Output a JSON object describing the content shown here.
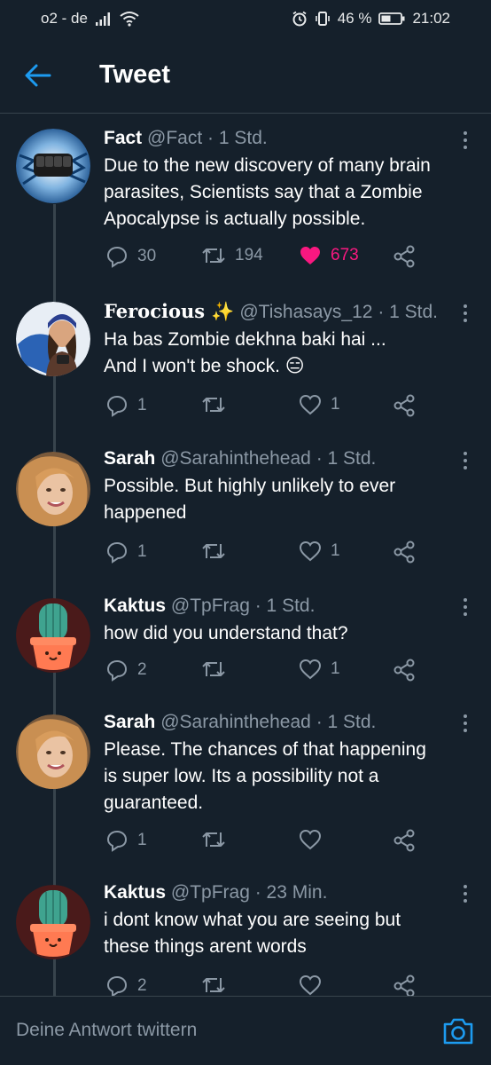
{
  "status": {
    "carrier": "o2 - de",
    "battery": "46 %",
    "time": "21:02"
  },
  "header": {
    "title": "Tweet"
  },
  "tweets": [
    {
      "name": "Fact",
      "handle": "@Fact",
      "time": "· 1 Std.",
      "lines": [
        "Due to the new discovery of many brain",
        "parasites, Scientists say that a Zombie",
        "Apocalypse is actually possible."
      ],
      "replies": "30",
      "retweets": "194",
      "likes": "673",
      "liked": true
    },
    {
      "name": "Ferocious ✨",
      "handle": "@Tishasays_12",
      "time": "· 1 Std.",
      "lines": [
        "Ha bas Zombie dekhna baki hai ...",
        "And I won't be shock. 😑"
      ],
      "replies": "1",
      "retweets": "",
      "likes": "1",
      "liked": false
    },
    {
      "name": "Sarah",
      "handle": "@Sarahinthehead",
      "time": "· 1 Std.",
      "lines": [
        "Possible. But highly unlikely to ever",
        "happened"
      ],
      "replies": "1",
      "retweets": "",
      "likes": "1",
      "liked": false
    },
    {
      "name": "Kaktus",
      "handle": "@TpFrag",
      "time": "· 1 Std.",
      "lines": [
        "how did you understand that?"
      ],
      "replies": "2",
      "retweets": "",
      "likes": "1",
      "liked": false
    },
    {
      "name": "Sarah",
      "handle": "@Sarahinthehead",
      "time": "· 1 Std.",
      "lines": [
        "Please. The chances of that happening",
        "is super low. Its a possibility not a",
        "guaranteed."
      ],
      "replies": "1",
      "retweets": "",
      "likes": "",
      "liked": false
    },
    {
      "name": "Kaktus",
      "handle": "@TpFrag",
      "time": "· 23 Min.",
      "lines": [
        "i dont know what you are seeing but",
        "these things arent words"
      ],
      "replies": "2",
      "retweets": "",
      "likes": "",
      "liked": false
    }
  ],
  "reply_bar": {
    "placeholder": "Deine Antwort twittern"
  },
  "colors": {
    "background": "#15202b",
    "accent": "#1d9bf0",
    "like": "#f91880",
    "muted": "#8b98a5",
    "divider": "#38444d"
  },
  "icons": {
    "back": "arrow-left-icon",
    "more": "more-vertical-icon",
    "reply": "reply-icon",
    "retweet": "retweet-icon",
    "like": "heart-icon",
    "share": "share-icon",
    "camera": "camera-icon"
  }
}
